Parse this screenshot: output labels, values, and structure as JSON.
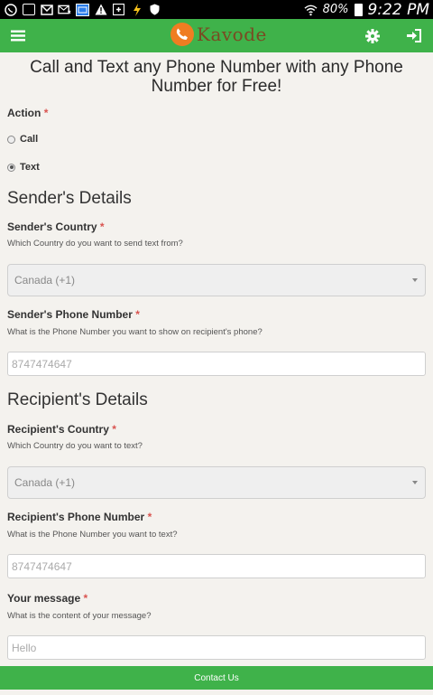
{
  "status_bar": {
    "battery": "80%",
    "time": "9:22 PM"
  },
  "header": {
    "brand": "Kavode"
  },
  "page": {
    "title": "Call and Text any Phone Number with any Phone Number for Free!"
  },
  "form": {
    "action": {
      "label": "Action",
      "required_mark": "*",
      "options": [
        {
          "label": "Call",
          "checked": false
        },
        {
          "label": "Text",
          "checked": true
        }
      ]
    },
    "sender": {
      "section_title": "Sender's Details",
      "country": {
        "label": "Sender's Country",
        "required_mark": "*",
        "help": "Which Country do you want to send text from?",
        "value": "Canada (+1)"
      },
      "phone": {
        "label": "Sender's Phone Number",
        "required_mark": "*",
        "help": "What is the Phone Number you want to show on recipient's phone?",
        "placeholder": "8747474647"
      }
    },
    "recipient": {
      "section_title": "Recipient's Details",
      "country": {
        "label": "Recipient's Country",
        "required_mark": "*",
        "help": "Which Country do you want to text?",
        "value": "Canada (+1)"
      },
      "phone": {
        "label": "Recipient's Phone Number",
        "required_mark": "*",
        "help": "What is the Phone Number you want to text?",
        "placeholder": "8747474647"
      }
    },
    "message": {
      "label": "Your message",
      "required_mark": "*",
      "help": "What is the content of your message?",
      "placeholder": "Hello"
    }
  },
  "footer": {
    "link": "Contact Us"
  },
  "colors": {
    "brand_green": "#3fb24a",
    "logo_orange": "#ef7d22",
    "required_red": "#d9534f"
  },
  "icons": [
    "whatsapp-icon",
    "gallery-icon",
    "gmail-icon",
    "mail-icon",
    "calendar-icon",
    "warning-icon",
    "google-plus-icon",
    "flash-icon",
    "shield-icon",
    "wifi-icon",
    "battery-icon",
    "menu-icon",
    "phone-icon",
    "settings-icon",
    "sign-in-icon"
  ]
}
